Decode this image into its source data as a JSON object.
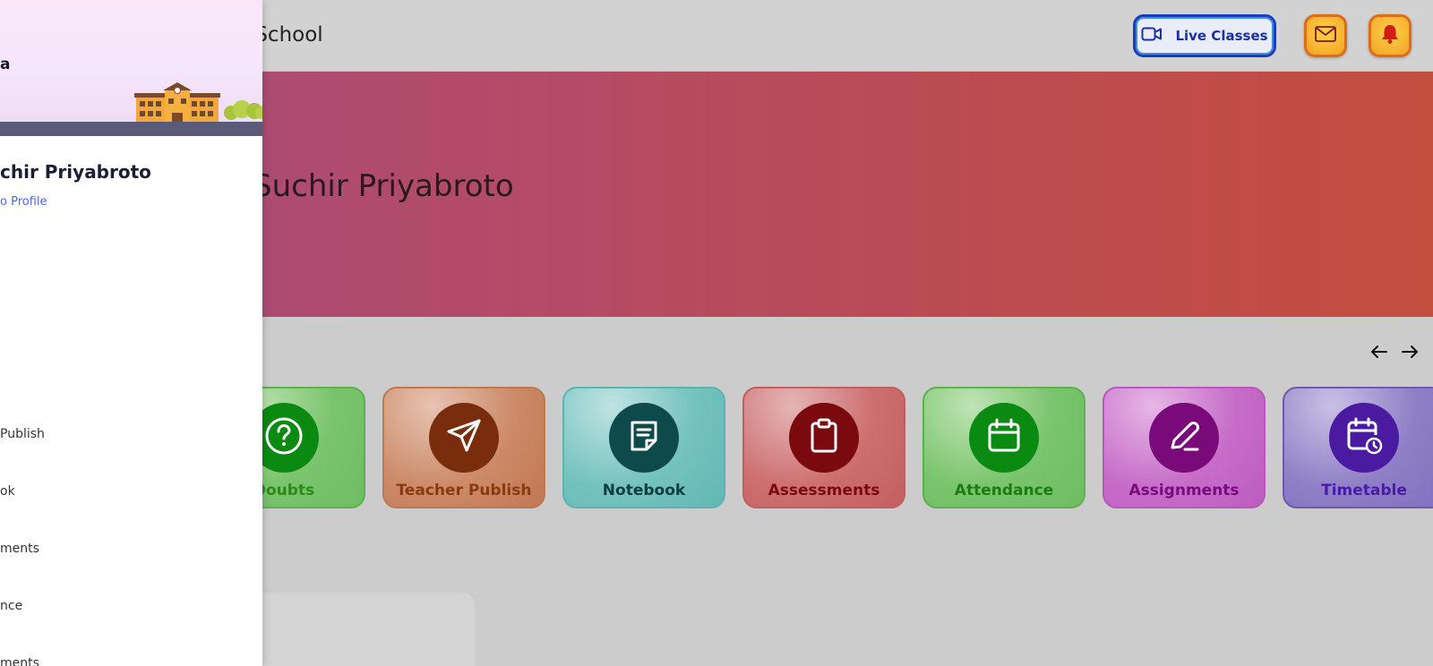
{
  "header": {
    "school_name": "t School",
    "live_classes_label": "Live Classes"
  },
  "banner": {
    "student_name": "Suchir Priyabroto"
  },
  "cards": [
    {
      "label": "Doubts",
      "icon": "question-circle-icon",
      "label_color": "#2c8a19",
      "circle_color": "#0a8a10"
    },
    {
      "label": "Teacher Publish",
      "icon": "send-icon",
      "label_color": "#8a3a0f",
      "circle_color": "#7a2d0d"
    },
    {
      "label": "Notebook",
      "icon": "notebook-icon",
      "label_color": "#0f3d40",
      "circle_color": "#0e4a4c"
    },
    {
      "label": "Assessments",
      "icon": "clipboard-icon",
      "label_color": "#7a0a12",
      "circle_color": "#7a0a0e"
    },
    {
      "label": "Attendance",
      "icon": "calendar-icon",
      "label_color": "#1a7d12",
      "circle_color": "#0a8a10"
    },
    {
      "label": "Assignments",
      "icon": "pencil-icon",
      "label_color": "#7a0a80",
      "circle_color": "#7a0a7a"
    },
    {
      "label": "Timetable",
      "icon": "calendar-clock-icon",
      "label_color": "#4a1aa8",
      "circle_color": "#4a1aa0"
    }
  ],
  "sidebar": {
    "school_fragment": "a",
    "student_name": "chir Priyabroto",
    "profile_link": "o Profile",
    "items": [
      {
        "label": " Publish"
      },
      {
        "label": "ok"
      },
      {
        "label": "ments"
      },
      {
        "label": "nce"
      },
      {
        "label": "ments"
      }
    ]
  },
  "colors": {
    "accent_blue": "#1a3dbf",
    "icon_button_orange": "#f3a326",
    "banner_start": "#a84b7b",
    "banner_end": "#c24e3e"
  }
}
